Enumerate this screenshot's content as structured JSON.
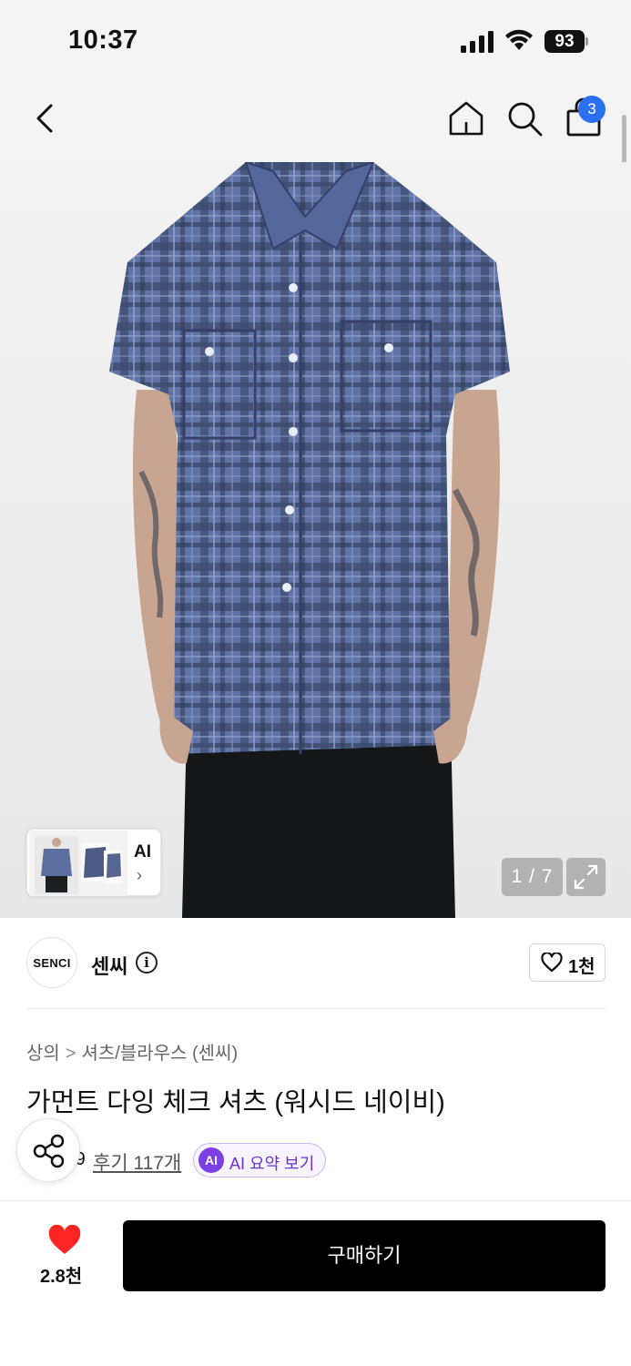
{
  "status_bar": {
    "time": "10:37",
    "battery": "93"
  },
  "nav": {
    "cart_count": "3"
  },
  "gallery": {
    "thumb_label": "AI",
    "counter": "1 / 7"
  },
  "brand": {
    "logo_text": "SENCI",
    "name": "센씨",
    "info_glyph": "i",
    "follow_count": "1천"
  },
  "breadcrumb": {
    "items": [
      "상의",
      "셔츠/블라우스 (센씨)"
    ],
    "separator": ">"
  },
  "product": {
    "title": "가먼트 다잉 체크 셔츠 (워시드 네이비)"
  },
  "rating": {
    "value": "4.9",
    "reviews": "후기 117개",
    "ai_badge": "AI",
    "ai_summary": "AI 요약 보기"
  },
  "bottom": {
    "like_count": "2.8천",
    "buy_label": "구매하기"
  },
  "colors": {
    "accent_blue": "#2b6ff5",
    "ai_purple": "#7b3fe4",
    "like_red": "#ff2424"
  }
}
